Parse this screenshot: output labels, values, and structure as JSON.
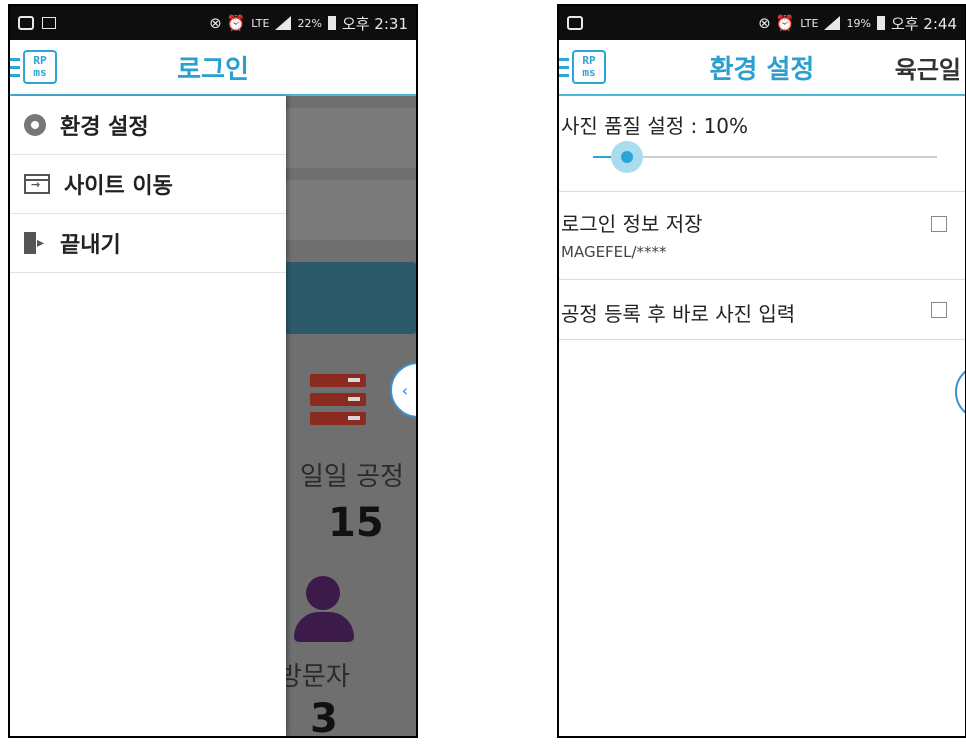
{
  "left_screen": {
    "status": {
      "alerts": "⊗ ⏰",
      "network": "LTE",
      "battery": "22%",
      "time": "오후 2:31"
    },
    "appbar": {
      "logo_text_top": "RP",
      "logo_text_bottom": "ms",
      "title": "로그인"
    },
    "drawer": {
      "items": [
        {
          "label": "환경 설정",
          "icon": "gear-icon"
        },
        {
          "label": "사이트 이동",
          "icon": "site-move-icon"
        },
        {
          "label": "끝내기",
          "icon": "exit-icon"
        }
      ]
    },
    "background": {
      "daily_process_label": "일일 공정",
      "daily_process_count": "15",
      "visitor_label": "방문자",
      "visitor_count": "3"
    },
    "handle_glyph": "‹"
  },
  "right_screen": {
    "status": {
      "alerts": "⊗ ⏰",
      "network": "LTE",
      "battery": "19%",
      "time": "오후 2:44"
    },
    "appbar": {
      "logo_text_top": "RP",
      "logo_text_bottom": "ms",
      "title": "환경 설정",
      "user": "육근일"
    },
    "settings": {
      "photo_quality": {
        "label": "사진 품질 설정 : 10%",
        "value_fraction": 0.1
      },
      "save_login": {
        "label": "로그인 정보 저장",
        "value": "MAGEFEL/****",
        "checked": false
      },
      "photo_after_register": {
        "label": "공정 등록 후 바로 사진 입력",
        "checked": false
      }
    },
    "handle_glyph": "‹"
  },
  "colors": {
    "accent": "#2aa5d6",
    "statusbar": "#0e0e0e",
    "overlay": "#6f6f6f"
  }
}
